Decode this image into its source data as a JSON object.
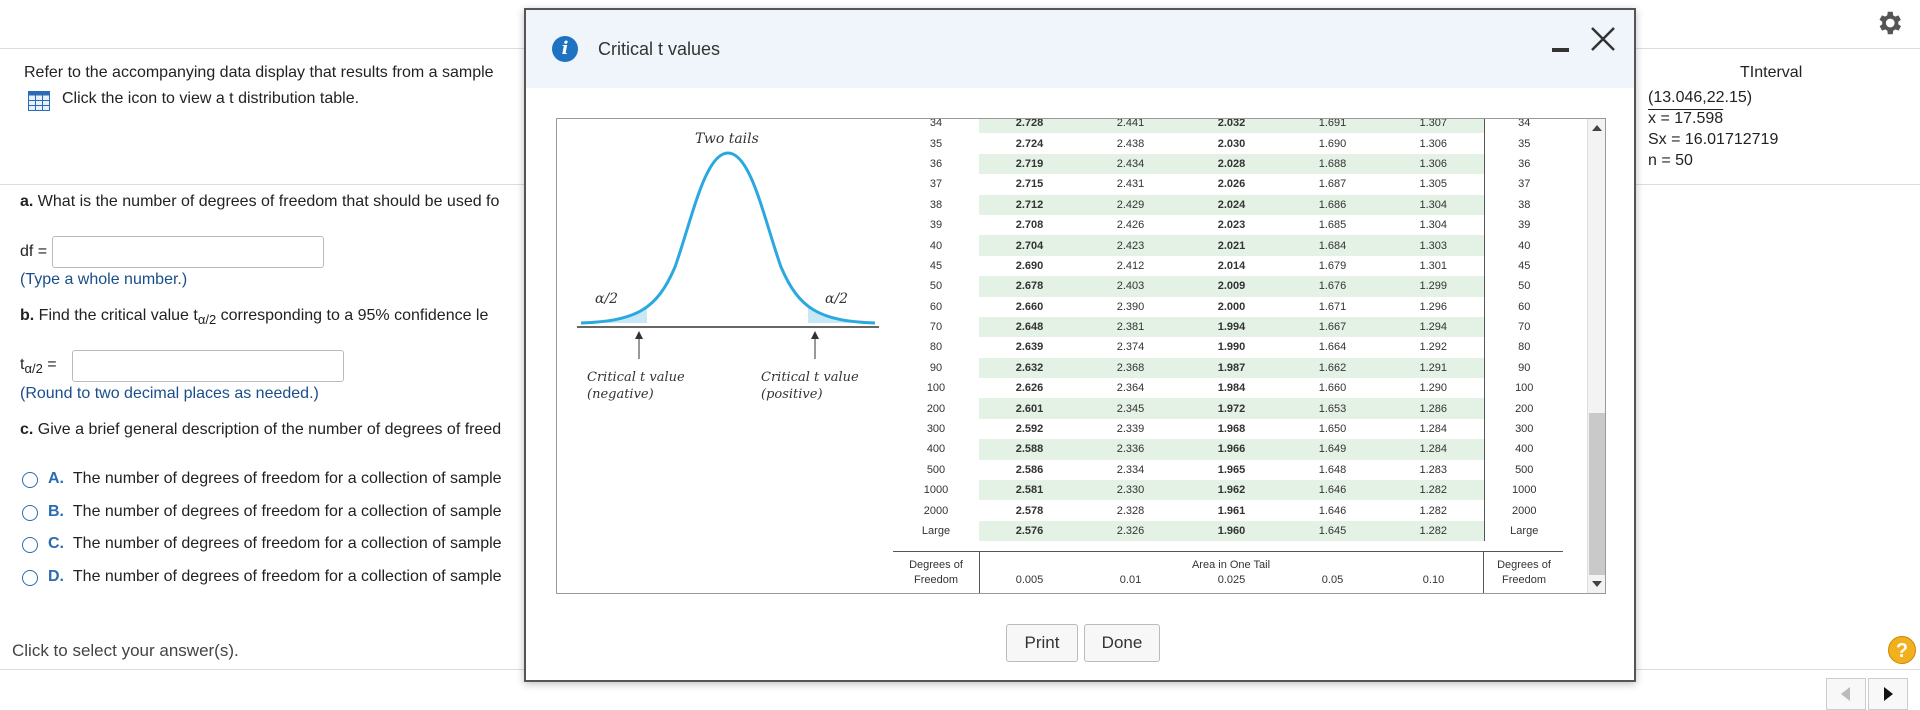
{
  "question": {
    "intro": "Refer to the accompanying data display that results from a sample",
    "table_link": "Click the icon to view a t distribution table.",
    "part_a": {
      "letter": "a.",
      "text": " What is the number of degrees of freedom that should be used fo",
      "label": "df =",
      "hint": "(Type a whole number.)"
    },
    "part_b": {
      "letter": "b.",
      "text_pre": " Find the critical value t",
      "sub": "α/2",
      "text_post": " corresponding to a 95% confidence le",
      "label_t": "t",
      "label_sub": "α/2",
      "label_eq": " =",
      "hint": "(Round to two decimal places as needed.)"
    },
    "part_c": {
      "letter": "c.",
      "text": " Give a brief general description of the number of degrees of freed"
    },
    "options": [
      {
        "letter": "A.",
        "text": "The number of degrees of freedom for a collection of sample"
      },
      {
        "letter": "B.",
        "text": "The number of degrees of freedom for a collection of sample"
      },
      {
        "letter": "C.",
        "text": "The number of degrees of freedom for a collection of sample"
      },
      {
        "letter": "D.",
        "text": "The number of degrees of freedom for a collection of sample"
      }
    ],
    "footer": "Click to select your answer(s)."
  },
  "tinterval": {
    "title": "TInterval",
    "interval": "(13.046,22.15)",
    "xbar": "x = 17.598",
    "sx": "Sx = 16.01712719",
    "n": "n = 50"
  },
  "modal": {
    "title": "Critical t values",
    "print_label": "Print",
    "done_label": "Done",
    "figure": {
      "title": "Two tails",
      "alpha_left": "α/2",
      "alpha_right": "α/2",
      "crit_neg_1": "Critical t value",
      "crit_neg_2": "(negative)",
      "crit_pos_1": "Critical t value",
      "crit_pos_2": "(positive)"
    },
    "table": {
      "header_df_1": "Degrees of",
      "header_df_2": "Freedom",
      "header_area": "Area in One Tail",
      "tails": [
        "0.005",
        "0.01",
        "0.025",
        "0.05",
        "0.10"
      ],
      "rows": [
        [
          "34",
          "2.728",
          "2.441",
          "2.032",
          "1.691",
          "1.307",
          "34"
        ],
        [
          "35",
          "2.724",
          "2.438",
          "2.030",
          "1.690",
          "1.306",
          "35"
        ],
        [
          "36",
          "2.719",
          "2.434",
          "2.028",
          "1.688",
          "1.306",
          "36"
        ],
        [
          "37",
          "2.715",
          "2.431",
          "2.026",
          "1.687",
          "1.305",
          "37"
        ],
        [
          "38",
          "2.712",
          "2.429",
          "2.024",
          "1.686",
          "1.304",
          "38"
        ],
        [
          "39",
          "2.708",
          "2.426",
          "2.023",
          "1.685",
          "1.304",
          "39"
        ],
        [
          "40",
          "2.704",
          "2.423",
          "2.021",
          "1.684",
          "1.303",
          "40"
        ],
        [
          "45",
          "2.690",
          "2.412",
          "2.014",
          "1.679",
          "1.301",
          "45"
        ],
        [
          "50",
          "2.678",
          "2.403",
          "2.009",
          "1.676",
          "1.299",
          "50"
        ],
        [
          "60",
          "2.660",
          "2.390",
          "2.000",
          "1.671",
          "1.296",
          "60"
        ],
        [
          "70",
          "2.648",
          "2.381",
          "1.994",
          "1.667",
          "1.294",
          "70"
        ],
        [
          "80",
          "2.639",
          "2.374",
          "1.990",
          "1.664",
          "1.292",
          "80"
        ],
        [
          "90",
          "2.632",
          "2.368",
          "1.987",
          "1.662",
          "1.291",
          "90"
        ],
        [
          "100",
          "2.626",
          "2.364",
          "1.984",
          "1.660",
          "1.290",
          "100"
        ],
        [
          "200",
          "2.601",
          "2.345",
          "1.972",
          "1.653",
          "1.286",
          "200"
        ],
        [
          "300",
          "2.592",
          "2.339",
          "1.968",
          "1.650",
          "1.284",
          "300"
        ],
        [
          "400",
          "2.588",
          "2.336",
          "1.966",
          "1.649",
          "1.284",
          "400"
        ],
        [
          "500",
          "2.586",
          "2.334",
          "1.965",
          "1.648",
          "1.283",
          "500"
        ],
        [
          "1000",
          "2.581",
          "2.330",
          "1.962",
          "1.646",
          "1.282",
          "1000"
        ],
        [
          "2000",
          "2.578",
          "2.328",
          "1.961",
          "1.646",
          "1.282",
          "2000"
        ],
        [
          "Large",
          "2.576",
          "2.326",
          "1.960",
          "1.645",
          "1.282",
          "Large"
        ]
      ]
    }
  },
  "colors": {
    "curve": "#29a9e0",
    "tail_fill": "#c9e8f6",
    "row_green": "#e4f1e5",
    "link_blue": "#1a4e8a"
  }
}
